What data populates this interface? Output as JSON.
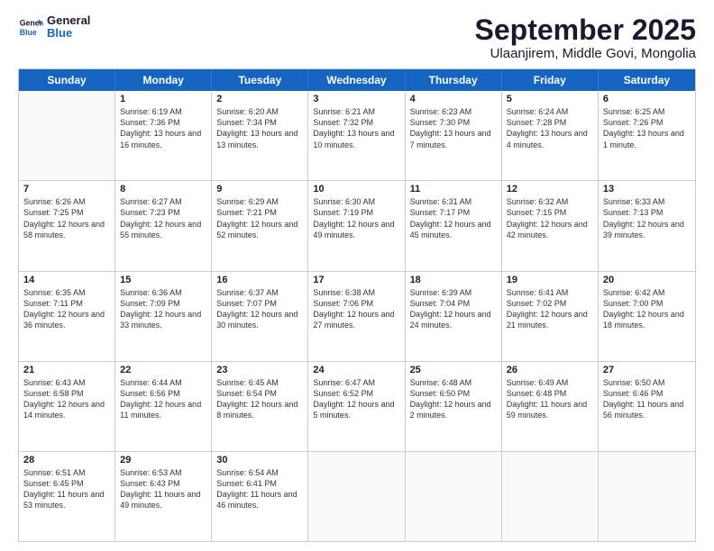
{
  "logo": {
    "line1": "General",
    "line2": "Blue"
  },
  "title": "September 2025",
  "location": "Ulaanjirem, Middle Govi, Mongolia",
  "header": {
    "days": [
      "Sunday",
      "Monday",
      "Tuesday",
      "Wednesday",
      "Thursday",
      "Friday",
      "Saturday"
    ]
  },
  "weeks": [
    [
      {
        "day": "",
        "sunrise": "",
        "sunset": "",
        "daylight": ""
      },
      {
        "day": "1",
        "sunrise": "Sunrise: 6:19 AM",
        "sunset": "Sunset: 7:36 PM",
        "daylight": "Daylight: 13 hours and 16 minutes."
      },
      {
        "day": "2",
        "sunrise": "Sunrise: 6:20 AM",
        "sunset": "Sunset: 7:34 PM",
        "daylight": "Daylight: 13 hours and 13 minutes."
      },
      {
        "day": "3",
        "sunrise": "Sunrise: 6:21 AM",
        "sunset": "Sunset: 7:32 PM",
        "daylight": "Daylight: 13 hours and 10 minutes."
      },
      {
        "day": "4",
        "sunrise": "Sunrise: 6:23 AM",
        "sunset": "Sunset: 7:30 PM",
        "daylight": "Daylight: 13 hours and 7 minutes."
      },
      {
        "day": "5",
        "sunrise": "Sunrise: 6:24 AM",
        "sunset": "Sunset: 7:28 PM",
        "daylight": "Daylight: 13 hours and 4 minutes."
      },
      {
        "day": "6",
        "sunrise": "Sunrise: 6:25 AM",
        "sunset": "Sunset: 7:26 PM",
        "daylight": "Daylight: 13 hours and 1 minute."
      }
    ],
    [
      {
        "day": "7",
        "sunrise": "Sunrise: 6:26 AM",
        "sunset": "Sunset: 7:25 PM",
        "daylight": "Daylight: 12 hours and 58 minutes."
      },
      {
        "day": "8",
        "sunrise": "Sunrise: 6:27 AM",
        "sunset": "Sunset: 7:23 PM",
        "daylight": "Daylight: 12 hours and 55 minutes."
      },
      {
        "day": "9",
        "sunrise": "Sunrise: 6:29 AM",
        "sunset": "Sunset: 7:21 PM",
        "daylight": "Daylight: 12 hours and 52 minutes."
      },
      {
        "day": "10",
        "sunrise": "Sunrise: 6:30 AM",
        "sunset": "Sunset: 7:19 PM",
        "daylight": "Daylight: 12 hours and 49 minutes."
      },
      {
        "day": "11",
        "sunrise": "Sunrise: 6:31 AM",
        "sunset": "Sunset: 7:17 PM",
        "daylight": "Daylight: 12 hours and 45 minutes."
      },
      {
        "day": "12",
        "sunrise": "Sunrise: 6:32 AM",
        "sunset": "Sunset: 7:15 PM",
        "daylight": "Daylight: 12 hours and 42 minutes."
      },
      {
        "day": "13",
        "sunrise": "Sunrise: 6:33 AM",
        "sunset": "Sunset: 7:13 PM",
        "daylight": "Daylight: 12 hours and 39 minutes."
      }
    ],
    [
      {
        "day": "14",
        "sunrise": "Sunrise: 6:35 AM",
        "sunset": "Sunset: 7:11 PM",
        "daylight": "Daylight: 12 hours and 36 minutes."
      },
      {
        "day": "15",
        "sunrise": "Sunrise: 6:36 AM",
        "sunset": "Sunset: 7:09 PM",
        "daylight": "Daylight: 12 hours and 33 minutes."
      },
      {
        "day": "16",
        "sunrise": "Sunrise: 6:37 AM",
        "sunset": "Sunset: 7:07 PM",
        "daylight": "Daylight: 12 hours and 30 minutes."
      },
      {
        "day": "17",
        "sunrise": "Sunrise: 6:38 AM",
        "sunset": "Sunset: 7:06 PM",
        "daylight": "Daylight: 12 hours and 27 minutes."
      },
      {
        "day": "18",
        "sunrise": "Sunrise: 6:39 AM",
        "sunset": "Sunset: 7:04 PM",
        "daylight": "Daylight: 12 hours and 24 minutes."
      },
      {
        "day": "19",
        "sunrise": "Sunrise: 6:41 AM",
        "sunset": "Sunset: 7:02 PM",
        "daylight": "Daylight: 12 hours and 21 minutes."
      },
      {
        "day": "20",
        "sunrise": "Sunrise: 6:42 AM",
        "sunset": "Sunset: 7:00 PM",
        "daylight": "Daylight: 12 hours and 18 minutes."
      }
    ],
    [
      {
        "day": "21",
        "sunrise": "Sunrise: 6:43 AM",
        "sunset": "Sunset: 6:58 PM",
        "daylight": "Daylight: 12 hours and 14 minutes."
      },
      {
        "day": "22",
        "sunrise": "Sunrise: 6:44 AM",
        "sunset": "Sunset: 6:56 PM",
        "daylight": "Daylight: 12 hours and 11 minutes."
      },
      {
        "day": "23",
        "sunrise": "Sunrise: 6:45 AM",
        "sunset": "Sunset: 6:54 PM",
        "daylight": "Daylight: 12 hours and 8 minutes."
      },
      {
        "day": "24",
        "sunrise": "Sunrise: 6:47 AM",
        "sunset": "Sunset: 6:52 PM",
        "daylight": "Daylight: 12 hours and 5 minutes."
      },
      {
        "day": "25",
        "sunrise": "Sunrise: 6:48 AM",
        "sunset": "Sunset: 6:50 PM",
        "daylight": "Daylight: 12 hours and 2 minutes."
      },
      {
        "day": "26",
        "sunrise": "Sunrise: 6:49 AM",
        "sunset": "Sunset: 6:48 PM",
        "daylight": "Daylight: 11 hours and 59 minutes."
      },
      {
        "day": "27",
        "sunrise": "Sunrise: 6:50 AM",
        "sunset": "Sunset: 6:46 PM",
        "daylight": "Daylight: 11 hours and 56 minutes."
      }
    ],
    [
      {
        "day": "28",
        "sunrise": "Sunrise: 6:51 AM",
        "sunset": "Sunset: 6:45 PM",
        "daylight": "Daylight: 11 hours and 53 minutes."
      },
      {
        "day": "29",
        "sunrise": "Sunrise: 6:53 AM",
        "sunset": "Sunset: 6:43 PM",
        "daylight": "Daylight: 11 hours and 49 minutes."
      },
      {
        "day": "30",
        "sunrise": "Sunrise: 6:54 AM",
        "sunset": "Sunset: 6:41 PM",
        "daylight": "Daylight: 11 hours and 46 minutes."
      },
      {
        "day": "",
        "sunrise": "",
        "sunset": "",
        "daylight": ""
      },
      {
        "day": "",
        "sunrise": "",
        "sunset": "",
        "daylight": ""
      },
      {
        "day": "",
        "sunrise": "",
        "sunset": "",
        "daylight": ""
      },
      {
        "day": "",
        "sunrise": "",
        "sunset": "",
        "daylight": ""
      }
    ]
  ]
}
